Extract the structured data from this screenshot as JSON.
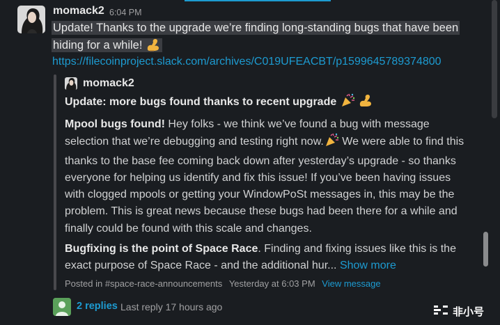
{
  "message": {
    "sender": "momack2",
    "time": "6:04 PM",
    "text": "Update! Thanks to the upgrade we’re finding long-standing bugs that have been hiding for a while!",
    "link": "https://filecoinproject.slack.com/archives/C019UFEACBT/p1599645789374800"
  },
  "quote": {
    "sender": "momack2",
    "title": "Update: more bugs found thanks to recent upgrade",
    "p1_bold": "Mpool bugs found!",
    "p1_a": " Hey folks - we think we’ve found a bug with message selection that we’re debugging and testing right now.",
    "p1_b": " We were able to find this thanks to the base fee coming back down after yesterday’s upgrade - so thanks everyone for helping us identify and fix this issue! If you’ve been having issues with clogged mpools or getting your WindowPoSt messages in, this may be the problem. This is great news because these bugs had been there for a while and finally could be found with this scale and changes.",
    "p2_bold": "Bugfixing is the point of Space Race",
    "p2_text": ". Finding and fixing issues like this is the exact purpose of Space Race - and the additional hur...",
    "show_more": "Show more",
    "posted_in": "Posted in #space-race-announcements",
    "posted_time": "Yesterday at 6:03 PM",
    "view_message": "View message"
  },
  "thread": {
    "replies": "2 replies",
    "last_reply": "Last reply 17 hours ago"
  },
  "watermark": {
    "text": "非小号"
  },
  "icons": {
    "flexed_biceps": "flexed-biceps-emoji",
    "party_popper": "party-popper-emoji"
  },
  "colors": {
    "background": "#1a1d21",
    "link": "#1d9bd1",
    "highlight": "#3b3d42"
  }
}
